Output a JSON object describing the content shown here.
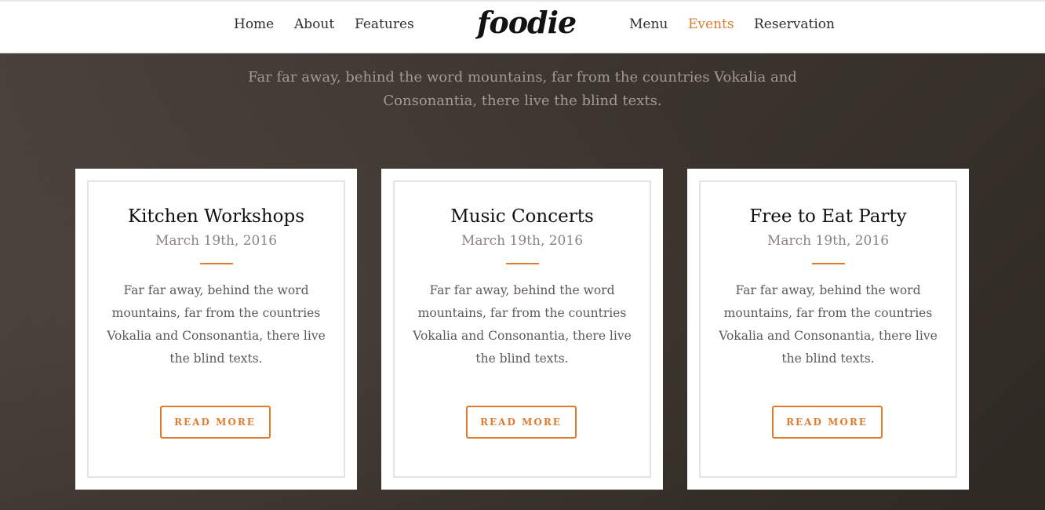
{
  "nav": {
    "left_links": [
      "Home",
      "About",
      "Features"
    ],
    "logo": "foodie",
    "right_links": [
      "Menu",
      "Events",
      "Reservation"
    ],
    "active": "Events",
    "accent_color": "#e07b2e"
  },
  "intro": {
    "text": "Far far away, behind the word mountains, far from the countries Vokalia and Consonantia, there live the blind texts."
  },
  "events": [
    {
      "title": "Kitchen Workshops",
      "date": "March 19th, 2016",
      "text": "Far far away, behind the word mountains, far from the countries Vokalia and Consonantia, there live the blind texts.",
      "button": "READ MORE"
    },
    {
      "title": "Music Concerts",
      "date": "March 19th, 2016",
      "text": "Far far away, behind the word mountains, far from the countries Vokalia and Consonantia, there live the blind texts.",
      "button": "READ MORE"
    },
    {
      "title": "Free to Eat Party",
      "date": "March 19th, 2016",
      "text": "Far far away, behind the word mountains, far from the countries Vokalia and Consonantia, there live the blind texts.",
      "button": "READ MORE"
    }
  ]
}
